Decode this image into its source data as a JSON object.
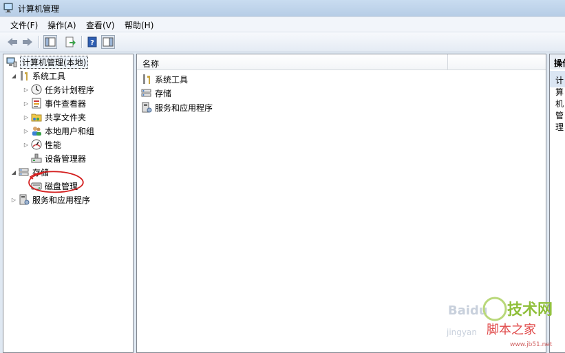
{
  "window": {
    "title": "计算机管理"
  },
  "menu": [
    "文件(F)",
    "操作(A)",
    "查看(V)",
    "帮助(H)"
  ],
  "tree": {
    "root": "计算机管理(本地)",
    "system_tools": "系统工具",
    "task_scheduler": "任务计划程序",
    "event_viewer": "事件查看器",
    "shared_folders": "共享文件夹",
    "local_users": "本地用户和组",
    "performance": "性能",
    "device_manager": "设备管理器",
    "storage": "存储",
    "disk_management": "磁盘管理",
    "services": "服务和应用程序"
  },
  "list": {
    "column_name": "名称",
    "items": [
      "系统工具",
      "存储",
      "服务和应用程序"
    ]
  },
  "actions": {
    "header": "操作",
    "item": "计算机管理"
  },
  "watermark": {
    "brand": "技术网",
    "site": "脚本之家",
    "url": "www.jb51.net",
    "baidu": "Baidu",
    "jingyan": "jingyan"
  },
  "colors": {
    "annotation": "#d42020",
    "selection": "#dbe6f3",
    "titlebar": "#c9dcf0"
  }
}
